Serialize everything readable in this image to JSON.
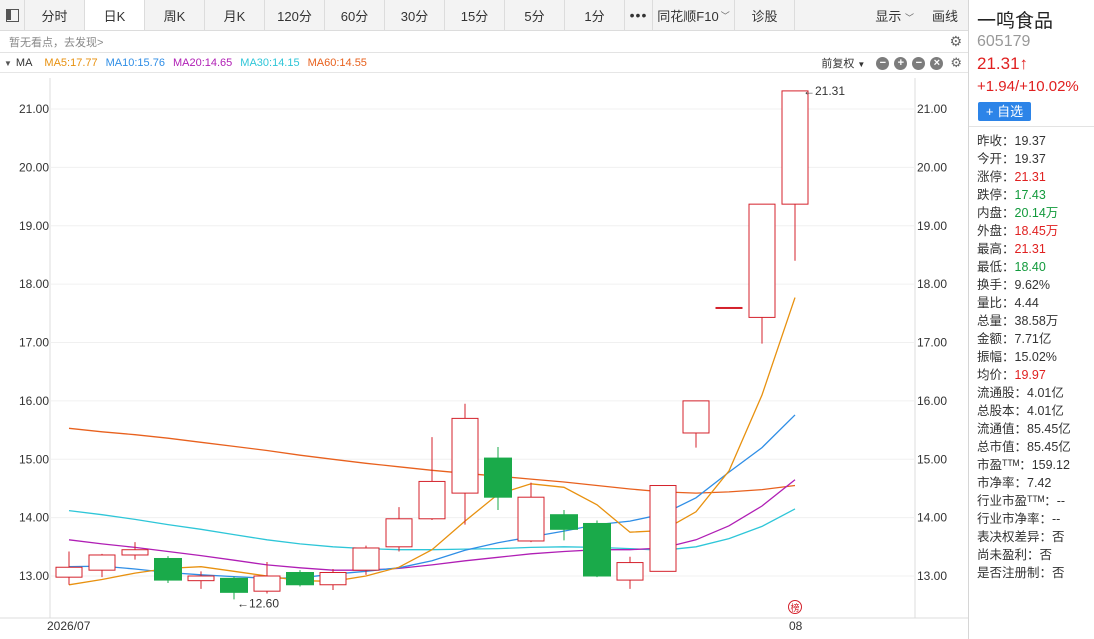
{
  "tabs": [
    {
      "label": "分时",
      "active": false
    },
    {
      "label": "日K",
      "active": true
    },
    {
      "label": "周K",
      "active": false
    },
    {
      "label": "月K",
      "active": false
    },
    {
      "label": "120分",
      "active": false
    },
    {
      "label": "60分",
      "active": false
    },
    {
      "label": "30分",
      "active": false
    },
    {
      "label": "15分",
      "active": false
    },
    {
      "label": "5分",
      "active": false
    },
    {
      "label": "1分",
      "active": false
    }
  ],
  "toolbar": {
    "more_label": "•••",
    "f10_label": "同花顺F10",
    "diagnose_label": "诊股",
    "display_label": "显示",
    "draw_label": "画线"
  },
  "comment": {
    "placeholder": "暂无看点，去发现>"
  },
  "ma_bar": {
    "name": "MA",
    "ma5": "MA5:17.77",
    "ma10": "MA10:15.76",
    "ma20": "MA20:14.65",
    "ma30": "MA30:14.15",
    "ma60": "MA60:14.55",
    "adjust_label": "前复权"
  },
  "colors": {
    "up": "#d4212b",
    "down": "#1aaa4a",
    "ma5": "#e8910f",
    "ma10": "#2f8ee6",
    "ma20": "#b01fb5",
    "ma30": "#2ec6d8",
    "ma60": "#e8611e"
  },
  "chart_data": {
    "type": "candlestick",
    "yticks": [
      "21.00",
      "20.00",
      "19.00",
      "18.00",
      "17.00",
      "16.00",
      "15.00",
      "14.00",
      "13.00"
    ],
    "ylim": [
      12.3,
      21.3
    ],
    "x_labels": [
      {
        "index": 0,
        "text": "2026/07"
      },
      {
        "index": 22,
        "text": "08"
      }
    ],
    "candles": [
      {
        "o": 12.98,
        "h": 13.42,
        "l": 12.85,
        "c": 13.15
      },
      {
        "o": 13.1,
        "h": 13.38,
        "l": 12.98,
        "c": 13.36
      },
      {
        "o": 13.36,
        "h": 13.58,
        "l": 13.28,
        "c": 13.45
      },
      {
        "o": 13.3,
        "h": 13.34,
        "l": 12.88,
        "c": 12.93
      },
      {
        "o": 12.92,
        "h": 13.08,
        "l": 12.78,
        "c": 13.0
      },
      {
        "o": 12.96,
        "h": 12.99,
        "l": 12.6,
        "c": 12.72
      },
      {
        "o": 12.74,
        "h": 13.24,
        "l": 12.7,
        "c": 13.0
      },
      {
        "o": 13.06,
        "h": 13.1,
        "l": 12.82,
        "c": 12.85
      },
      {
        "o": 12.85,
        "h": 13.12,
        "l": 12.76,
        "c": 13.06
      },
      {
        "o": 13.1,
        "h": 13.52,
        "l": 13.02,
        "c": 13.48
      },
      {
        "o": 13.5,
        "h": 14.18,
        "l": 13.42,
        "c": 13.98
      },
      {
        "o": 13.98,
        "h": 15.38,
        "l": 13.96,
        "c": 14.62
      },
      {
        "o": 14.42,
        "h": 15.95,
        "l": 13.88,
        "c": 15.7
      },
      {
        "o": 15.02,
        "h": 15.21,
        "l": 14.13,
        "c": 14.35
      },
      {
        "o": 13.6,
        "h": 14.6,
        "l": 13.58,
        "c": 14.35
      },
      {
        "o": 14.05,
        "h": 14.13,
        "l": 13.61,
        "c": 13.8
      },
      {
        "o": 13.9,
        "h": 13.95,
        "l": 12.98,
        "c": 13.0
      },
      {
        "o": 12.93,
        "h": 13.33,
        "l": 12.78,
        "c": 13.23
      },
      {
        "o": 13.08,
        "h": 14.55,
        "l": 13.08,
        "c": 14.55
      },
      {
        "o": 15.45,
        "h": 16.0,
        "l": 15.2,
        "c": 16.0
      },
      {
        "o": 17.6,
        "h": 17.6,
        "l": 17.6,
        "c": 17.6
      },
      {
        "o": 17.43,
        "h": 19.37,
        "l": 16.98,
        "c": 19.37
      },
      {
        "o": 19.37,
        "h": 21.31,
        "l": 18.4,
        "c": 21.31
      }
    ],
    "ma5": [
      12.85,
      12.94,
      13.05,
      13.13,
      13.16,
      13.08,
      13.0,
      12.92,
      12.91,
      13.0,
      13.15,
      13.45,
      13.94,
      14.4,
      14.58,
      14.52,
      14.22,
      13.75,
      13.78,
      14.1,
      14.8,
      16.1,
      17.77
    ],
    "ma10": [
      13.16,
      13.17,
      13.12,
      13.06,
      13.02,
      12.99,
      12.96,
      12.97,
      13.03,
      13.08,
      13.14,
      13.26,
      13.44,
      13.57,
      13.67,
      13.77,
      13.88,
      13.94,
      14.06,
      14.34,
      14.78,
      15.2,
      15.76
    ],
    "ma20": [
      13.62,
      13.55,
      13.49,
      13.42,
      13.35,
      13.27,
      13.19,
      13.14,
      13.1,
      13.1,
      13.13,
      13.19,
      13.26,
      13.32,
      13.38,
      13.42,
      13.45,
      13.45,
      13.48,
      13.62,
      13.86,
      14.2,
      14.65
    ],
    "ma30": [
      14.12,
      14.05,
      13.97,
      13.88,
      13.8,
      13.71,
      13.62,
      13.55,
      13.5,
      13.47,
      13.45,
      13.45,
      13.46,
      13.47,
      13.49,
      13.5,
      13.49,
      13.47,
      13.44,
      13.5,
      13.64,
      13.85,
      14.15
    ],
    "ma60": [
      15.53,
      15.47,
      15.42,
      15.36,
      15.29,
      15.22,
      15.15,
      15.07,
      15.0,
      14.93,
      14.87,
      14.81,
      14.76,
      14.71,
      14.66,
      14.61,
      14.55,
      14.49,
      14.44,
      14.42,
      14.44,
      14.48,
      14.55
    ],
    "high_marker": {
      "index": 22,
      "text": "21.31"
    },
    "low_marker": {
      "index": 5,
      "text": "12.60"
    },
    "badge": "榜"
  },
  "stock": {
    "name": "一鸣食品",
    "code": "605179",
    "price": "21.31↑",
    "change": "+1.94/+10.02%",
    "add_label": "+ 自选",
    "stats": [
      {
        "k": "昨收：",
        "v": "19.37",
        "c": ""
      },
      {
        "k": "今开：",
        "v": "19.37",
        "c": ""
      },
      {
        "k": "涨停：",
        "v": "21.31",
        "c": "up"
      },
      {
        "k": "跌停：",
        "v": "17.43",
        "c": "down"
      },
      {
        "k": "内盘：",
        "v": "20.14万",
        "c": "down"
      },
      {
        "k": "外盘：",
        "v": "18.45万",
        "c": "up"
      },
      {
        "k": "最高：",
        "v": "21.31",
        "c": "up"
      },
      {
        "k": "最低：",
        "v": "18.40",
        "c": "down"
      },
      {
        "k": "换手：",
        "v": "9.62%",
        "c": ""
      },
      {
        "k": "量比：",
        "v": "4.44",
        "c": ""
      },
      {
        "k": "总量：",
        "v": "38.58万",
        "c": ""
      },
      {
        "k": "金额：",
        "v": "7.71亿",
        "c": ""
      },
      {
        "k": "振幅：",
        "v": "15.02%",
        "c": ""
      },
      {
        "k": "均价：",
        "v": "19.97",
        "c": "up"
      },
      {
        "k": "流通股：",
        "v": "4.01亿",
        "c": ""
      },
      {
        "k": "总股本：",
        "v": "4.01亿",
        "c": ""
      },
      {
        "k": "流通值：",
        "v": "85.45亿",
        "c": ""
      },
      {
        "k": "总市值：",
        "v": "85.45亿",
        "c": ""
      },
      {
        "k": "市盈ᵀᵀᴹ：",
        "v": "159.12",
        "c": ""
      },
      {
        "k": "市净率：",
        "v": "7.42",
        "c": ""
      },
      {
        "k": "行业市盈ᵀᵀᴹ：",
        "v": "--",
        "c": ""
      },
      {
        "k": "行业市净率：",
        "v": "--",
        "c": ""
      },
      {
        "k": "表决权差异：",
        "v": "否",
        "c": ""
      },
      {
        "k": "尚未盈利：",
        "v": "否",
        "c": ""
      },
      {
        "k": "是否注册制：",
        "v": "否",
        "c": ""
      }
    ]
  }
}
